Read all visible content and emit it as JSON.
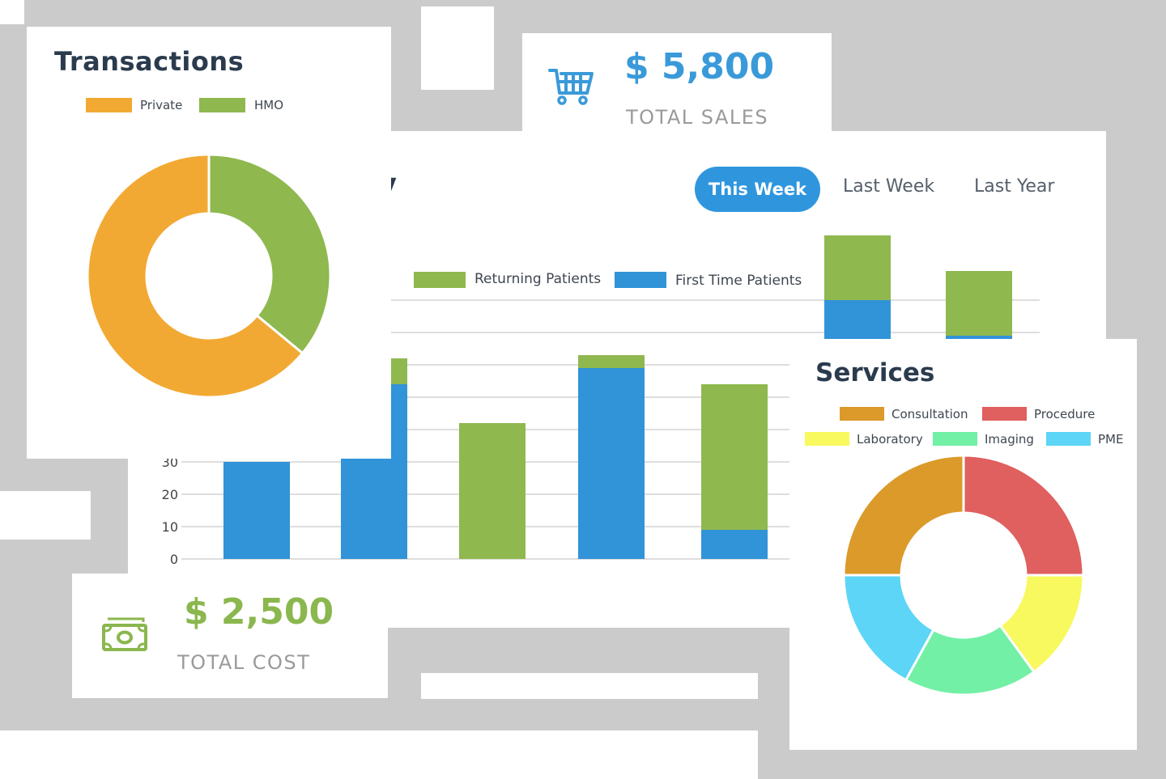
{
  "summary": {
    "title": "Summary",
    "title_visible": "mmary",
    "tabs": [
      {
        "label": "This Week",
        "active": true
      },
      {
        "label": "Last Week",
        "active": false
      },
      {
        "label": "Last Year",
        "active": false
      }
    ]
  },
  "transactions": {
    "title": "Transactions",
    "legend": [
      "Private",
      "HMO"
    ]
  },
  "sales": {
    "value": "$ 5,800",
    "label": "TOTAL SALES",
    "icon": "shopping-cart-icon"
  },
  "cost": {
    "value": "$ 2,500",
    "label": "TOTAL COST",
    "icon": "money-bill-icon"
  },
  "services": {
    "title": "Services",
    "legend": [
      "Consultation",
      "Procedure",
      "Laboratory",
      "Imaging",
      "PME"
    ]
  },
  "colors": {
    "accent_blue": "#2f96de",
    "returning": "#8fb84f",
    "first_time": "#3193d8",
    "private": "#f2a933",
    "hmo": "#8fb84f",
    "consultation": "#db9a29",
    "procedure": "#e05f5f",
    "laboratory": "#f8f85f",
    "imaging": "#72f0a6",
    "pme": "#5dd5f6"
  },
  "chart_data": [
    {
      "type": "bar",
      "stacked": true,
      "categories": [
        "",
        "",
        "",
        "",
        "",
        "",
        ""
      ],
      "y_ticks": [
        "0",
        "10",
        "20",
        "30"
      ],
      "ylim": [
        0,
        80
      ],
      "legend": "top",
      "series": [
        {
          "name": "First Time Patients",
          "values": [
            30,
            54,
            0,
            59,
            9,
            80,
            69
          ]
        },
        {
          "name": "Returning Patients",
          "values": [
            0,
            8,
            42,
            4,
            45,
            20,
            20
          ]
        }
      ]
    },
    {
      "type": "pie",
      "donut": true,
      "labels": [
        "Private",
        "HMO"
      ],
      "values": [
        64,
        36
      ],
      "legend": "top"
    },
    {
      "type": "pie",
      "donut": true,
      "labels": [
        "Consultation",
        "Procedure",
        "Laboratory",
        "Imaging",
        "PME"
      ],
      "values": [
        25,
        25,
        15,
        18,
        17
      ],
      "legend": "top"
    }
  ]
}
